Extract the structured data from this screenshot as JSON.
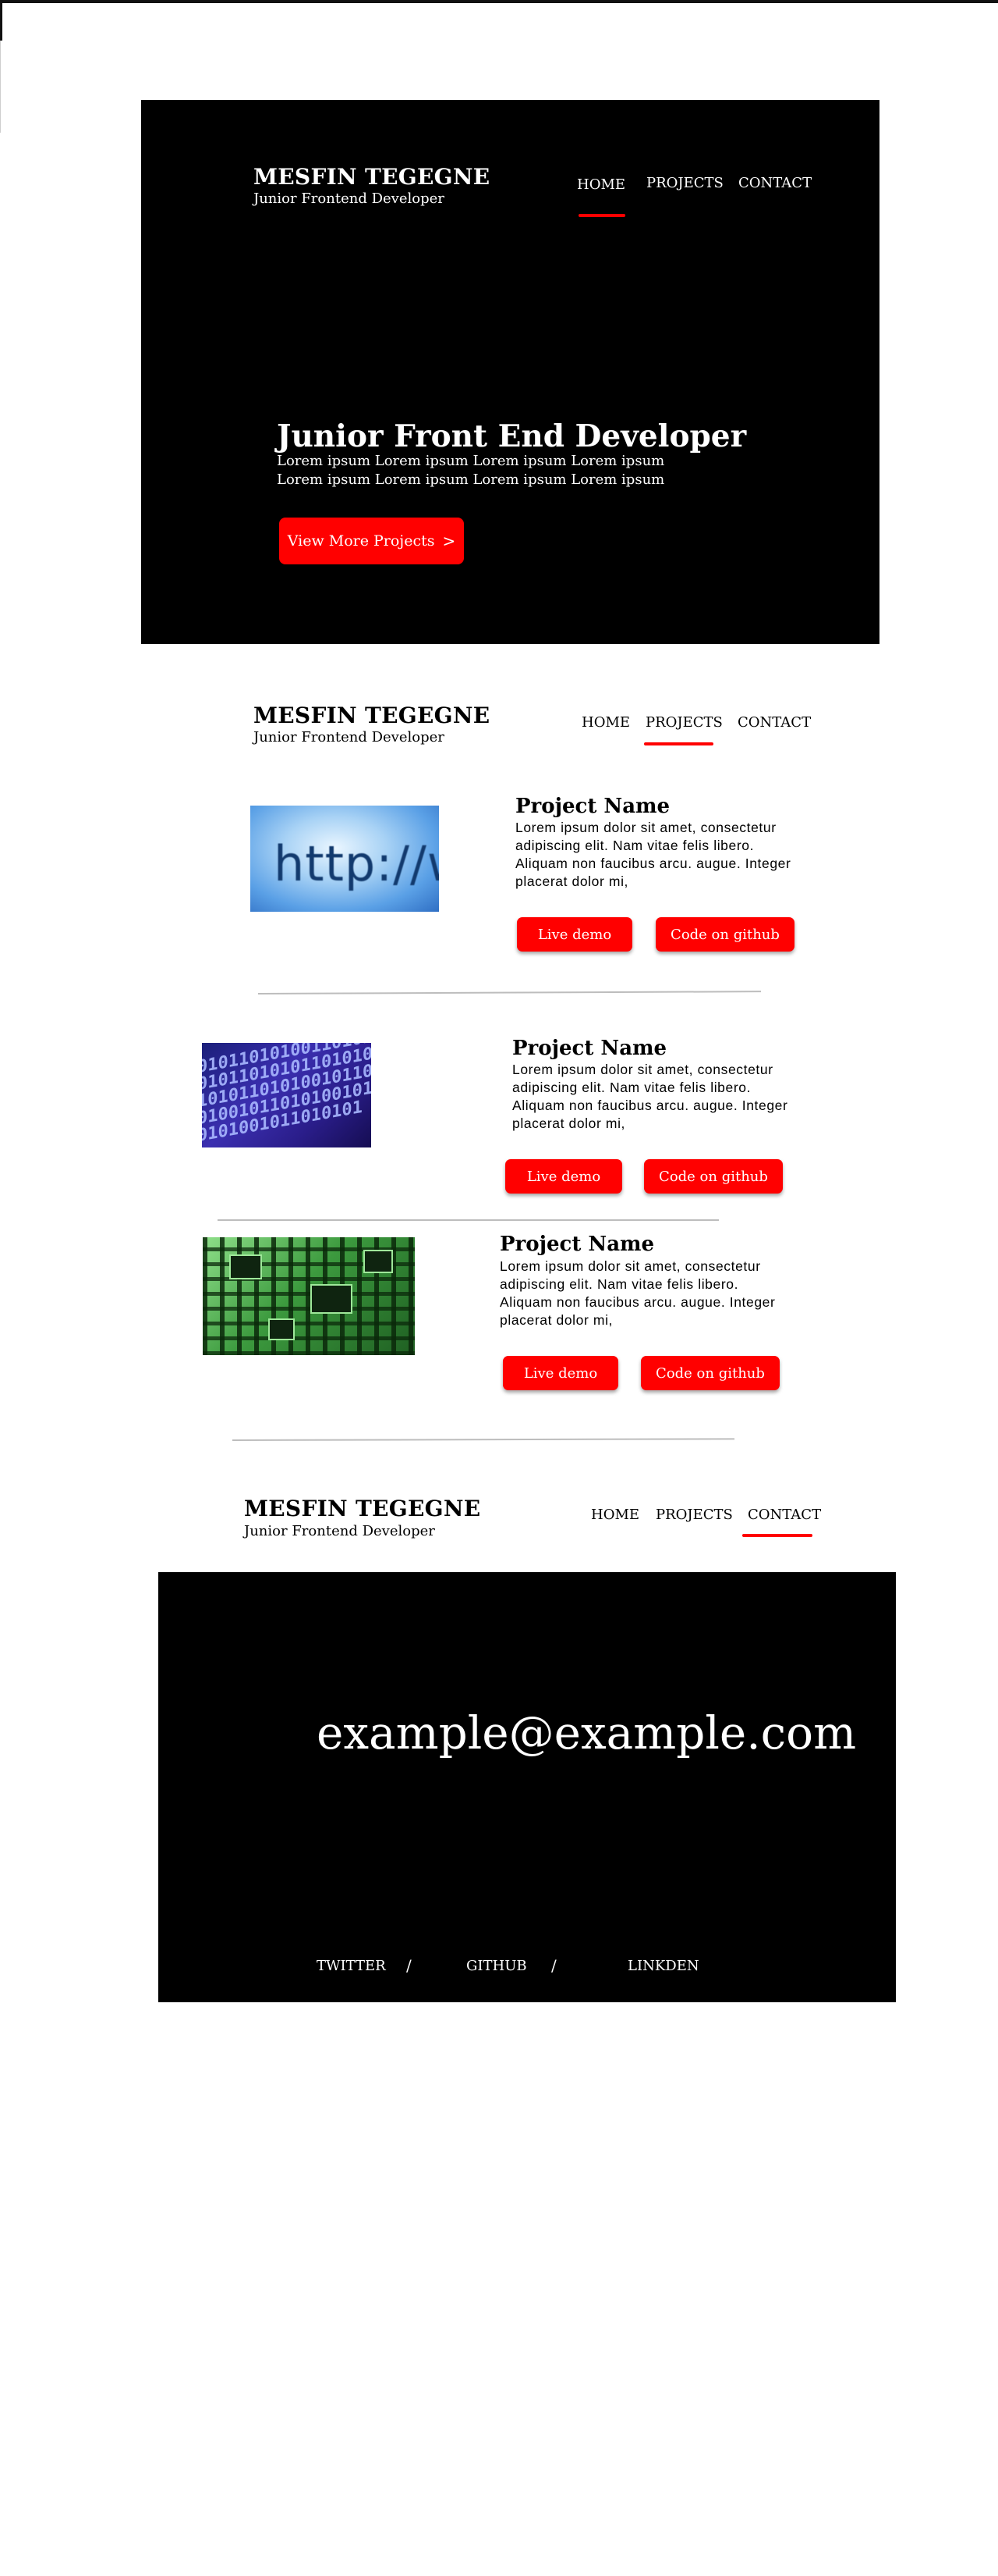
{
  "brand": {
    "name": "MESFIN TEGEGNE",
    "subtitle": "Junior Frontend Developer"
  },
  "nav": {
    "home": "HOME",
    "projects": "PROJECTS",
    "contact": "CONTACT"
  },
  "accent_color": "#ff0000",
  "hero": {
    "title": "Junior Front End Developer",
    "lines": [
      "Lorem ipsum Lorem ipsum Lorem ipsum Lorem ipsum",
      "Lorem ipsum Lorem ipsum Lorem ipsum Lorem ipsum"
    ],
    "cta_label": "View More Projects",
    "cta_icon": ">"
  },
  "projects": [
    {
      "image": "http-url-image",
      "image_text": "http://www",
      "title": "Project Name",
      "description": "Lorem ipsum dolor sit amet, consectetur adipiscing elit. Nam vitae felis libero. Aliquam non faucibus arcu. augue. Integer placerat dolor mi,",
      "demo_label": "Live demo",
      "code_label": "Code on github"
    },
    {
      "image": "binary-code-image",
      "image_text": "0101101010011010100101101010110101001010110101001011010100101101010010110101001011010101",
      "title": "Project Name",
      "description": "Lorem ipsum dolor sit amet, consectetur adipiscing elit. Nam vitae felis libero. Aliquam non faucibus arcu. augue. Integer placerat dolor mi,",
      "demo_label": "Live demo",
      "code_label": "Code on github"
    },
    {
      "image": "circuit-board-image",
      "title": "Project Name",
      "description": "Lorem ipsum dolor sit amet, consectetur adipiscing elit. Nam vitae felis libero. Aliquam non faucibus arcu. augue. Integer placerat dolor mi,",
      "demo_label": "Live demo",
      "code_label": "Code on github"
    }
  ],
  "contact": {
    "email": "example@example.com",
    "links": [
      "TWITTER",
      "GITHUB",
      "LINKDEN"
    ],
    "separator": "/"
  }
}
